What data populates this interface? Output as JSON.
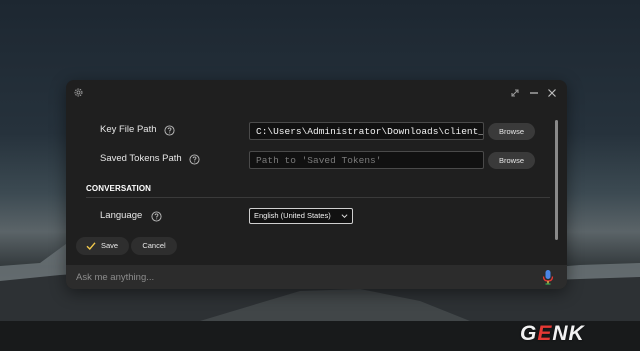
{
  "colors": {
    "window_bg": "#1f1f1f",
    "input_bg": "#111111",
    "button_bg": "#3a3a3a",
    "mic_blue": "#4a86e8",
    "mic_red": "#e53935",
    "save_check": "#f2c94c"
  },
  "icons": {
    "settings": "gear-icon",
    "expand": "expand-icon",
    "minimize": "minimize-icon",
    "close": "close-icon",
    "help": "help-circle-icon",
    "save": "check-icon",
    "mic": "microphone-icon"
  },
  "settings": {
    "key_file": {
      "label": "Key File Path",
      "value": "C:\\Users\\Administrator\\Downloads\\client_s",
      "browse_label": "Browse"
    },
    "saved_tokens": {
      "label": "Saved Tokens Path",
      "placeholder": "Path to 'Saved Tokens'",
      "browse_label": "Browse"
    },
    "conversation": {
      "section_title": "CONVERSATION",
      "language_label": "Language",
      "language_value": "English (United States)"
    }
  },
  "actions": {
    "save_label": "Save",
    "cancel_label": "Cancel"
  },
  "ask": {
    "placeholder": "Ask me anything..."
  },
  "watermark": {
    "brand_prefix": "G",
    "brand_accent": "E",
    "brand_suffix": "NK"
  }
}
